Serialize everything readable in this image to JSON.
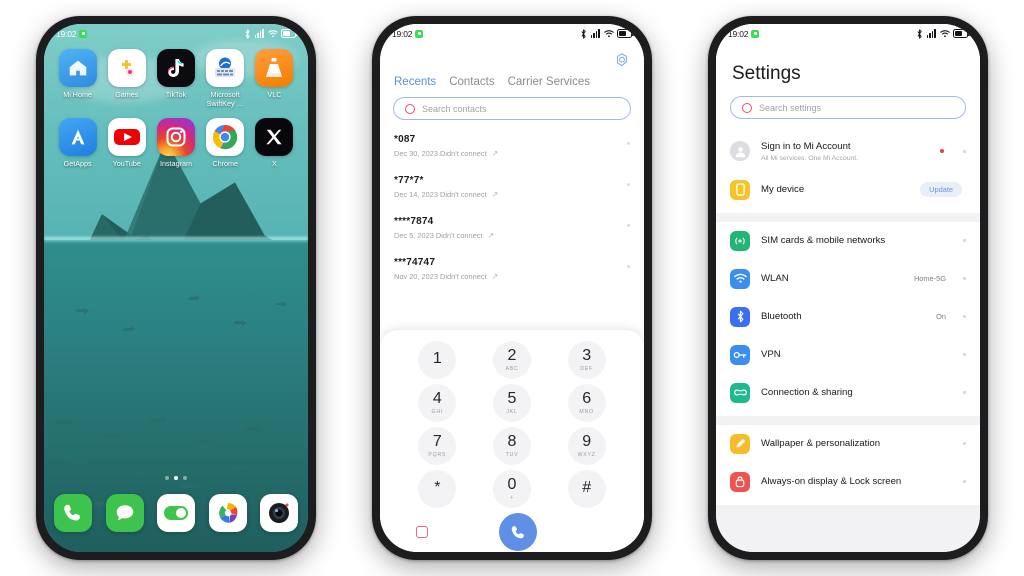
{
  "scene": {
    "background": "#ffffff",
    "phone_count": 3
  },
  "phone1": {
    "name": "home-screen",
    "status_bar": {
      "time": "19:02",
      "icons": [
        "screen-recorder-icon",
        "bluetooth-icon",
        "signal-icon",
        "wifi-icon",
        "battery-icon"
      ]
    },
    "apps": [
      {
        "label": "Mi Home",
        "icon": "mi-home-icon"
      },
      {
        "label": "Games",
        "icon": "games-icon"
      },
      {
        "label": "TikTok",
        "icon": "tiktok-icon"
      },
      {
        "label": "Microsoft SwiftKey …",
        "icon": "swiftkey-icon"
      },
      {
        "label": "VLC",
        "icon": "vlc-icon"
      },
      {
        "label": "GetApps",
        "icon": "getapps-icon"
      },
      {
        "label": "YouTube",
        "icon": "youtube-icon"
      },
      {
        "label": "Instagram",
        "icon": "instagram-icon"
      },
      {
        "label": "Chrome",
        "icon": "chrome-icon"
      },
      {
        "label": "X",
        "icon": "x-twitter-icon"
      }
    ],
    "page_dots": {
      "count": 3,
      "active_index": 1
    },
    "dock": [
      {
        "label": "Phone",
        "icon": "phone-icon"
      },
      {
        "label": "Messages",
        "icon": "messages-icon"
      },
      {
        "label": "Settings",
        "icon": "settings-toggle-icon"
      },
      {
        "label": "Gallery",
        "icon": "gallery-icon"
      },
      {
        "label": "Camera",
        "icon": "camera-icon"
      }
    ],
    "wallpaper": "underwater-mountain-fish"
  },
  "phone2": {
    "name": "dialer-app",
    "status_bar": {
      "time": "19:02"
    },
    "gear_label": "settings-gear",
    "tabs": [
      {
        "label": "Recents",
        "active": true
      },
      {
        "label": "Contacts",
        "active": false
      },
      {
        "label": "Carrier Services",
        "active": false
      }
    ],
    "search": {
      "placeholder": "Search contacts",
      "value": ""
    },
    "calls": [
      {
        "number": "*087",
        "meta": "Dec 30, 2023 Didn't connect"
      },
      {
        "number": "*77*7*",
        "meta": "Dec 14, 2023 Didn't connect"
      },
      {
        "number": "****7874",
        "meta": "Dec 5, 2023 Didn't connect"
      },
      {
        "number": "***74747",
        "meta": "Nov 20, 2023 Didn't connect"
      }
    ],
    "keypad": [
      {
        "digit": "1",
        "letters": ""
      },
      {
        "digit": "2",
        "letters": "ABC"
      },
      {
        "digit": "3",
        "letters": "DEF"
      },
      {
        "digit": "4",
        "letters": "GHI"
      },
      {
        "digit": "5",
        "letters": "JKL"
      },
      {
        "digit": "6",
        "letters": "MNO"
      },
      {
        "digit": "7",
        "letters": "PQRS"
      },
      {
        "digit": "8",
        "letters": "TUV"
      },
      {
        "digit": "9",
        "letters": "WXYZ"
      },
      {
        "digit": "*",
        "letters": ""
      },
      {
        "digit": "0",
        "letters": "+"
      },
      {
        "digit": "#",
        "letters": ""
      }
    ],
    "actions": {
      "recent_label": "recent-apps-button",
      "call_label": "call-button",
      "back_label": "back-button"
    },
    "accent": "#5f90e5"
  },
  "phone3": {
    "name": "settings-app",
    "status_bar": {
      "time": "19:02"
    },
    "title": "Settings",
    "search": {
      "placeholder": "Search settings",
      "value": ""
    },
    "account_group": [
      {
        "label": "Sign in to Mi Account",
        "sub": "All Mi services. One Mi Account.",
        "icon": "account-avatar-icon",
        "badge": "dot",
        "value": ""
      },
      {
        "label": "My device",
        "sub": "",
        "icon": "my-device-icon",
        "badge": "update",
        "badge_text": "Update",
        "value": ""
      }
    ],
    "connectivity_group": [
      {
        "label": "SIM cards & mobile networks",
        "icon": "sim-icon",
        "value": "",
        "color": "#23b573"
      },
      {
        "label": "WLAN",
        "icon": "wifi-icon",
        "value": "Home-5G",
        "color": "#3a8ef0"
      },
      {
        "label": "Bluetooth",
        "icon": "bluetooth-icon",
        "value": "On",
        "color": "#3a6ff0"
      },
      {
        "label": "VPN",
        "icon": "vpn-key-icon",
        "value": "",
        "color": "#3a8ef0"
      },
      {
        "label": "Connection & sharing",
        "icon": "sharing-icon",
        "value": "",
        "color": "#1fb98c"
      }
    ],
    "display_group": [
      {
        "label": "Wallpaper & personalization",
        "icon": "wallpaper-icon",
        "value": "",
        "color": "#f5bc2b"
      },
      {
        "label": "Always-on display & Lock screen",
        "icon": "lockscreen-icon",
        "value": "",
        "color": "#ef5350"
      }
    ]
  }
}
